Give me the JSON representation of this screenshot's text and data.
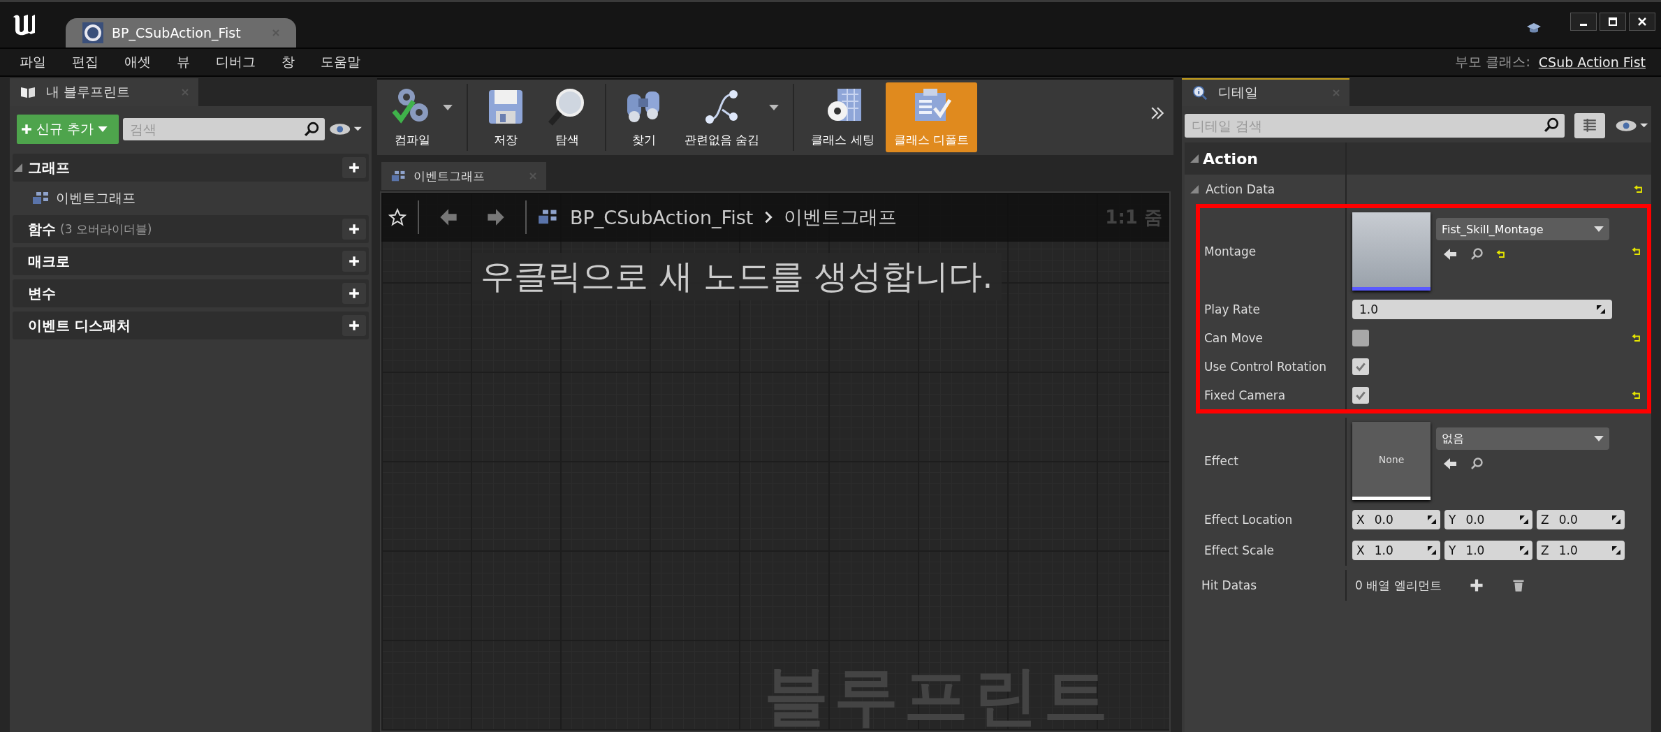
{
  "window": {
    "tab_title": "BP_CSubAction_Fist"
  },
  "menu": [
    "파일",
    "편집",
    "애셋",
    "뷰",
    "디버그",
    "창",
    "도움말"
  ],
  "parent_class": {
    "label": "부모 클래스:",
    "value": "CSub Action Fist"
  },
  "my_blueprint": {
    "tab": "내 블루프린트",
    "add_button": "신규 추가",
    "search_placeholder": "검색",
    "sections": [
      {
        "label": "그래프",
        "expanded": true,
        "children": [
          {
            "label": "이벤트그래프"
          }
        ]
      },
      {
        "label": "함수",
        "note": "(3 오버라이더블)",
        "expanded": false
      },
      {
        "label": "매크로",
        "expanded": false
      },
      {
        "label": "변수",
        "expanded": false
      },
      {
        "label": "이벤트 디스패처",
        "expanded": false
      }
    ]
  },
  "toolbar": [
    {
      "kind": "compile",
      "label": "컴파일",
      "dropdown": true,
      "separator_after": true,
      "selected": false
    },
    {
      "kind": "save",
      "label": "저장",
      "dropdown": false,
      "separator_after": false,
      "selected": false
    },
    {
      "kind": "browse",
      "label": "탐색",
      "dropdown": false,
      "separator_after": true,
      "selected": false
    },
    {
      "kind": "find",
      "label": "찾기",
      "dropdown": false,
      "separator_after": false,
      "selected": false
    },
    {
      "kind": "hide",
      "label": "관련없음 숨김",
      "dropdown": true,
      "separator_after": true,
      "selected": false
    },
    {
      "kind": "settings",
      "label": "클래스 세팅",
      "dropdown": false,
      "separator_after": false,
      "selected": false
    },
    {
      "kind": "defaults",
      "label": "클래스 디폴트",
      "dropdown": false,
      "separator_after": false,
      "selected": true
    }
  ],
  "graph": {
    "tab": "이벤트그래프",
    "breadcrumb_root": "BP_CSubAction_Fist",
    "breadcrumb_current": "이벤트그래프",
    "zoom": "1:1 줌",
    "hint": "우클릭으로 새 노드를 생성합니다.",
    "watermark": "블루프린트"
  },
  "details": {
    "tab": "디테일",
    "search_placeholder": "디테일 검색",
    "category": "Action",
    "items": [
      {
        "kind": "group",
        "label": "Action Data",
        "expanded": true,
        "reset": true,
        "children": [
          {
            "kind": "asset",
            "label": "Montage",
            "value": "Fist_Skill_Montage",
            "color": "#5a5aff",
            "reset": true,
            "inline_reset": true,
            "highlighted": true
          },
          {
            "kind": "number",
            "label": "Play Rate",
            "value": "1.0",
            "reset": false,
            "highlighted": true
          },
          {
            "kind": "checkbox",
            "label": "Can Move",
            "checked": false,
            "reset": true,
            "highlighted": true
          },
          {
            "kind": "checkbox",
            "label": "Use Control Rotation",
            "checked": true,
            "reset": false,
            "highlighted": true
          },
          {
            "kind": "checkbox",
            "label": "Fixed Camera",
            "checked": true,
            "reset": true,
            "highlighted": true
          },
          {
            "kind": "asset",
            "label": "Effect",
            "value": "없음",
            "thumb_label": "None",
            "color": "#ffffff",
            "reset": false,
            "inline_reset": false,
            "highlighted": false
          },
          {
            "kind": "vector",
            "label": "Effect Location",
            "values": [
              {
                "axis": "X",
                "value": "0.0"
              },
              {
                "axis": "Y",
                "value": "0.0"
              },
              {
                "axis": "Z",
                "value": "0.0"
              }
            ],
            "reset": false,
            "highlighted": false
          },
          {
            "kind": "vector",
            "label": "Effect Scale",
            "values": [
              {
                "axis": "X",
                "value": "1.0"
              },
              {
                "axis": "Y",
                "value": "1.0"
              },
              {
                "axis": "Z",
                "value": "1.0"
              }
            ],
            "reset": false,
            "highlighted": false
          }
        ]
      },
      {
        "kind": "array",
        "label": "Hit Datas",
        "value": "0 배열 엘리먼트",
        "reset": false
      }
    ]
  }
}
